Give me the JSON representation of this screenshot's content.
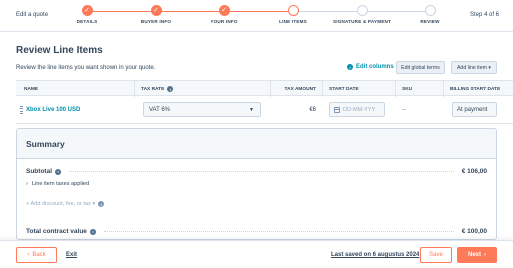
{
  "header": {
    "edit_quote": "Edit a quote",
    "step_counter": "Step 4 of 6",
    "steps": [
      {
        "label": "DETAILS",
        "state": "done"
      },
      {
        "label": "BUYER INFO",
        "state": "done"
      },
      {
        "label": "YOUR INFO",
        "state": "done"
      },
      {
        "label": "LINE ITEMS",
        "state": "current"
      },
      {
        "label": "SIGNATURE & PAYMENT",
        "state": "todo"
      },
      {
        "label": "REVIEW",
        "state": "todo"
      }
    ],
    "check_glyph": "✓"
  },
  "page": {
    "title": "Review Line Items",
    "subtitle": "Review the line items you want shown in your quote.",
    "edit_columns": "Edit columns",
    "edit_global_terms": "Edit global terms",
    "add_line_item": "Add line item ▾"
  },
  "table": {
    "columns": [
      "NAME",
      "TAX RATE",
      "TAX AMOUNT",
      "START DATE",
      "SKU",
      "BILLING START DATE"
    ],
    "rows": [
      {
        "name": "Xbox Live 100 USD",
        "tax_rate": "VAT 6%",
        "tax_amount": "€6",
        "start_date_placeholder": "DD-MM-YYY",
        "sku": "--",
        "billing_start": "At payment"
      }
    ]
  },
  "summary": {
    "title": "Summary",
    "subtotal_label": "Subtotal",
    "subtotal_value": "€ 106,00",
    "taxes_applied": "Line item taxes applied",
    "add_discount": "+ Add discount, fee, or tax ▾",
    "total_label": "Total contract value",
    "total_value": "€ 100,00"
  },
  "footer": {
    "back": "Back",
    "exit": "Exit",
    "last_saved": "Last saved on 6 augustus 2024",
    "save": "Save",
    "next": "Next"
  },
  "colors": {
    "accent": "#ff7a59",
    "link": "#0091ae",
    "text": "#33475b"
  }
}
